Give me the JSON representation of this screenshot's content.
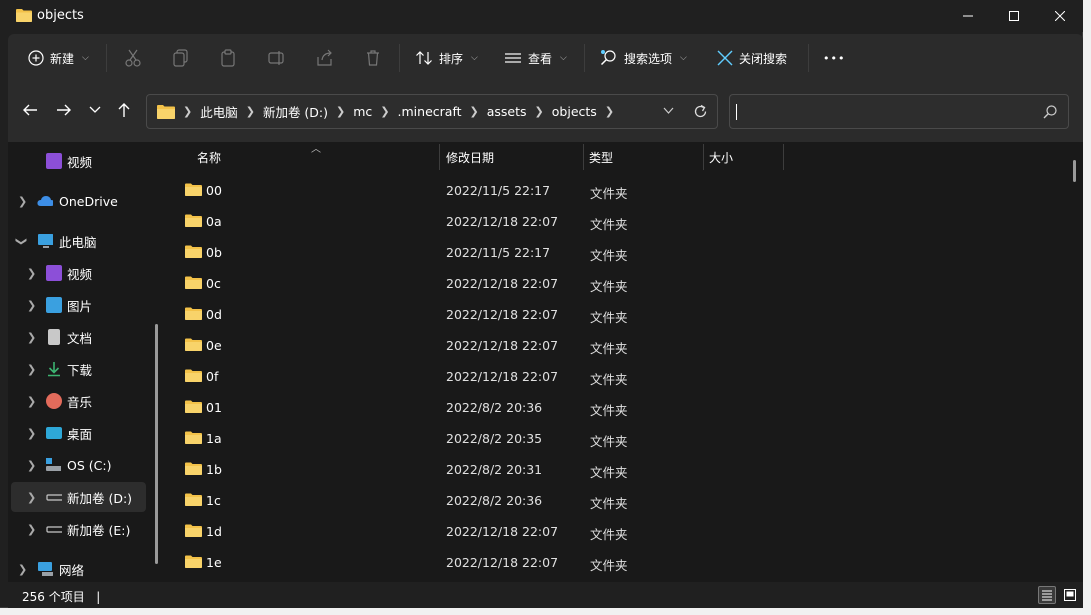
{
  "window": {
    "title": "objects",
    "minimize": "—",
    "maximize": "☐",
    "close": "✕"
  },
  "toolbar": {
    "new_label": "新建",
    "sort_label": "排序",
    "view_label": "查看",
    "search_options_label": "搜索选项",
    "close_search_label": "关闭搜索",
    "more_label": "•••"
  },
  "address": {
    "crumbs": [
      "此电脑",
      "新加卷 (D:)",
      "mc",
      ".minecraft",
      "assets",
      "objects"
    ]
  },
  "search": {
    "placeholder": ""
  },
  "sidebar": {
    "items": [
      {
        "label": "视频",
        "expandable": false,
        "icon": "video-icon",
        "color": "#8c4fd8"
      },
      {
        "label": "OneDrive",
        "expandable": true,
        "icon": "cloud-icon",
        "color": "#3d8ee6"
      },
      {
        "label": "此电脑",
        "expandable": true,
        "expanded": true,
        "icon": "computer-icon",
        "color": "#3aa0e0"
      },
      {
        "label": "视频",
        "expandable": true,
        "icon": "video-icon",
        "color": "#8c4fd8"
      },
      {
        "label": "图片",
        "expandable": true,
        "icon": "pictures-icon",
        "color": "#3aa0e0"
      },
      {
        "label": "文档",
        "expandable": true,
        "icon": "documents-icon",
        "color": "#c8c8c8"
      },
      {
        "label": "下载",
        "expandable": true,
        "icon": "download-icon",
        "color": "#3cb371"
      },
      {
        "label": "音乐",
        "expandable": true,
        "icon": "music-icon",
        "color": "#e36b5b"
      },
      {
        "label": "桌面",
        "expandable": true,
        "icon": "desktop-icon",
        "color": "#2ea8d8"
      },
      {
        "label": "OS (C:)",
        "expandable": true,
        "icon": "drive-icon",
        "color": "#9aa0a6"
      },
      {
        "label": "新加卷 (D:)",
        "expandable": true,
        "selected": true,
        "icon": "drive-icon",
        "color": "#9aa0a6"
      },
      {
        "label": "新加卷 (E:)",
        "expandable": true,
        "icon": "drive-icon",
        "color": "#9aa0a6"
      },
      {
        "label": "网络",
        "expandable": true,
        "icon": "network-icon",
        "color": "#3aa0e0"
      }
    ]
  },
  "columns": {
    "name": "名称",
    "modified": "修改日期",
    "type": "类型",
    "size": "大小"
  },
  "files": [
    {
      "name": "00",
      "modified": "2022/11/5 22:17",
      "type": "文件夹"
    },
    {
      "name": "0a",
      "modified": "2022/12/18 22:07",
      "type": "文件夹"
    },
    {
      "name": "0b",
      "modified": "2022/11/5 22:17",
      "type": "文件夹"
    },
    {
      "name": "0c",
      "modified": "2022/12/18 22:07",
      "type": "文件夹"
    },
    {
      "name": "0d",
      "modified": "2022/12/18 22:07",
      "type": "文件夹"
    },
    {
      "name": "0e",
      "modified": "2022/12/18 22:07",
      "type": "文件夹"
    },
    {
      "name": "0f",
      "modified": "2022/12/18 22:07",
      "type": "文件夹"
    },
    {
      "name": "01",
      "modified": "2022/8/2 20:36",
      "type": "文件夹"
    },
    {
      "name": "1a",
      "modified": "2022/8/2 20:35",
      "type": "文件夹"
    },
    {
      "name": "1b",
      "modified": "2022/8/2 20:31",
      "type": "文件夹"
    },
    {
      "name": "1c",
      "modified": "2022/8/2 20:36",
      "type": "文件夹"
    },
    {
      "name": "1d",
      "modified": "2022/12/18 22:07",
      "type": "文件夹"
    },
    {
      "name": "1e",
      "modified": "2022/12/18 22:07",
      "type": "文件夹"
    }
  ],
  "status": {
    "count": "256 个项目",
    "divider": "|"
  },
  "colors": {
    "folder": "#f3c249",
    "accent": "#60cdff"
  }
}
